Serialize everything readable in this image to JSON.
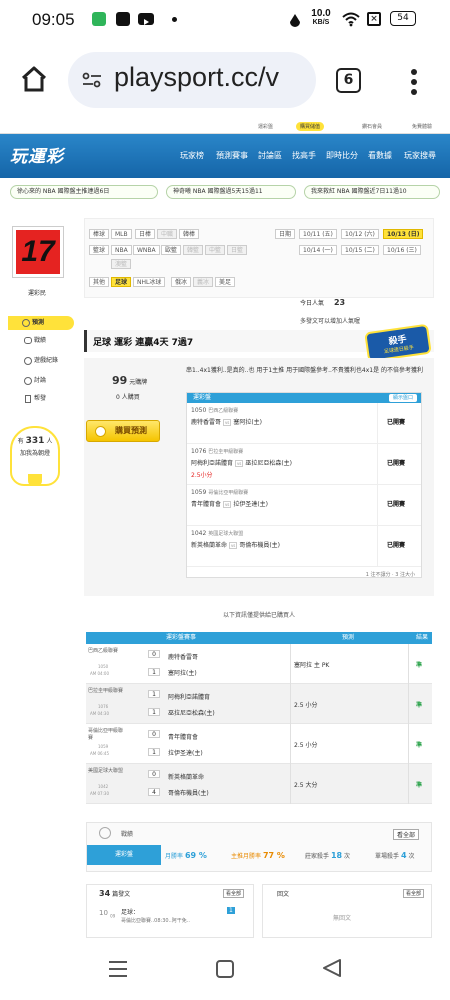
{
  "status": {
    "time": "09:05",
    "net_speed_value": "10.0",
    "net_speed_unit": "KB/S",
    "battery": "54"
  },
  "browser": {
    "url": "playsport.cc/v",
    "tab_count": "6"
  },
  "site": {
    "topbar": [
      "運彩盤",
      "購買儲值",
      "鑽石會員",
      "免費體驗"
    ],
    "logo": "玩運彩",
    "nav": [
      "玩家榜",
      "預測賽事",
      "討論區",
      "找高手",
      "即時比分",
      "看數據",
      "玩家搜尋"
    ],
    "tickers": [
      "徐心來的 NBA 國際盤主推連過6日",
      "神奇曦 NBA 國際盤過5天15過11",
      "我來救紅 NBA 國際盤近7日11過10"
    ]
  },
  "sidebar": {
    "avatar_text": "17",
    "username": "運彩民",
    "items": [
      "預測",
      "戰績",
      "遊戲紀錄",
      "討論",
      "帮發"
    ],
    "bulb_text_prefix": "有",
    "bulb_count": "331",
    "bulb_text_suffix": "人",
    "bulb_text_line2": "加我為朝燈"
  },
  "filters": {
    "row1_label": "棒球",
    "row1": [
      "MLB",
      "日棒",
      "中職",
      "韓棒"
    ],
    "row2_label": "籃球",
    "row2": [
      "NBA",
      "WNBA",
      "歐籃",
      "韓籃",
      "中籃",
      "日籃",
      "澳籃"
    ],
    "row3_label": "其他",
    "row3": [
      "足球",
      "NHL冰球",
      "俄冰",
      "義冰",
      "美足"
    ],
    "date_label": "日期",
    "dates_row1": [
      "10/11 (五)",
      "10/12 (六)",
      "10/13 (日)"
    ],
    "dates_row2": [
      "10/14 (一)",
      "10/15 (二)",
      "10/16 (三)"
    ]
  },
  "stats": {
    "today_label": "今日人氣",
    "today_count": "23",
    "note": "多發文可以增加人氣喔"
  },
  "banner": {
    "title": "足球 運彩 連贏4天 7過7",
    "badge": "殺手",
    "badge_sub": "足球連日殺手"
  },
  "purchase": {
    "price": "99",
    "price_unit": "元購牌",
    "buyers": "0",
    "buyers_unit": "人購買",
    "button": "購買預測",
    "desc": "串1..4x1獲利..是真的..也 用于1主推 用于國際盤參考..不貴獲利也4x1是 的不倍參考獲利",
    "pick_header": "運彩盤",
    "pick_button": "顯示盤口",
    "picks": [
      {
        "code": "1050",
        "league": "巴西乙級聯賽",
        "home": "鹿特香雷哥",
        "away": "塞阿拉(主)",
        "status": "已開賽",
        "tag": ""
      },
      {
        "code": "1076",
        "league": "巴拉圭甲級聯賽",
        "home": "阿梅利亞諾體育",
        "away": "巫拉尼亞松森(主)",
        "status": "已開賽",
        "tag": "2.5小分"
      },
      {
        "code": "1059",
        "league": "哥倫比亞甲級聯賽",
        "home": "青年體育會",
        "away": "拉伊圣達(主)",
        "status": "已開賽",
        "tag": ""
      },
      {
        "code": "1042",
        "league": "英國足球大聯盟",
        "home": "新英格蘭革命",
        "away": "哥倫布機員(主)",
        "status": "已開賽",
        "tag": ""
      }
    ],
    "pick_footer": "1 注不讓分 · 3 注大小"
  },
  "provider_note": "以下資訊僅提供給已購買人",
  "results": {
    "headers": [
      "運彩盤賽事",
      "預測",
      "結果"
    ],
    "rows": [
      {
        "league": "巴西乙級聯賽",
        "code": "1050",
        "time": "AM 04:00",
        "s1": "0",
        "s2": "1",
        "home": "鹿特香雷哥",
        "away": "塞阿拉(主)",
        "pick": "塞阿拉 主 PK",
        "result": "準"
      },
      {
        "league": "巴拉圭甲級聯賽",
        "code": "1076",
        "time": "AM 04:30",
        "s1": "1",
        "s2": "1",
        "home": "阿梅利亞諾體育",
        "away": "巫拉尼亞松森(主)",
        "pick": "2.5 小分",
        "result": "準"
      },
      {
        "league": "哥倫比亞甲級聯賽",
        "code": "1059",
        "time": "AM 06:45",
        "s1": "0",
        "s2": "1",
        "home": "青年體育會",
        "away": "拉伊圣達(主)",
        "pick": "2.5 小分",
        "result": "準"
      },
      {
        "league": "美國足球大聯盟",
        "code": "1042",
        "time": "AM 07:30",
        "s1": "0",
        "s2": "4",
        "home": "新英格蘭革命",
        "away": "哥倫布機員(主)",
        "pick": "2.5 大分",
        "result": "準"
      }
    ]
  },
  "record": {
    "title": "戰績",
    "view_all": "看全部",
    "tab": "運彩盤",
    "monthly_label": "月勝率",
    "monthly_value": "69 %",
    "season_label": "主推月勝率",
    "season_value": "77 %",
    "killer_label": "莊家殺手",
    "killer_value": "18",
    "killer_unit": "次",
    "streak_label": "單場殺手",
    "streak_value": "4",
    "streak_unit": "次"
  },
  "posts": {
    "count": "34",
    "title": "篇發文",
    "view_all": "看全部",
    "item_day": "10",
    "item_month": "09",
    "item_title": "足球：",
    "item_text": "哥倫比亞聯賽..08:30..阿干免..",
    "item_badge": "1",
    "reply_title": "回文",
    "reply_view_all": "看全部",
    "reply_empty": "無回文"
  }
}
